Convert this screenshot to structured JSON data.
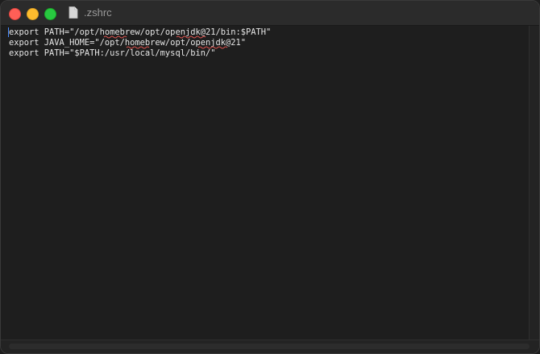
{
  "window": {
    "title": ".zshrc"
  },
  "editor": {
    "lines": [
      "export PATH=\"/opt/homebrew/opt/openjdk@21/bin:$PATH\"",
      "export JAVA_HOME=\"/opt/homebrew/opt/openjdk@21\"",
      "export PATH=\"$PATH:/usr/local/mysql/bin/\""
    ]
  },
  "icons": {
    "document": "document-icon",
    "close": "close-button",
    "minimize": "minimize-button",
    "zoom": "zoom-button"
  },
  "colors": {
    "background": "#1e1e1e",
    "text": "#e6e6e6",
    "caret": "#4a8cff",
    "spellcheck_underline": "#d9534f",
    "close": "#ff5f57",
    "minimize": "#febc2e",
    "zoom": "#28c840"
  }
}
